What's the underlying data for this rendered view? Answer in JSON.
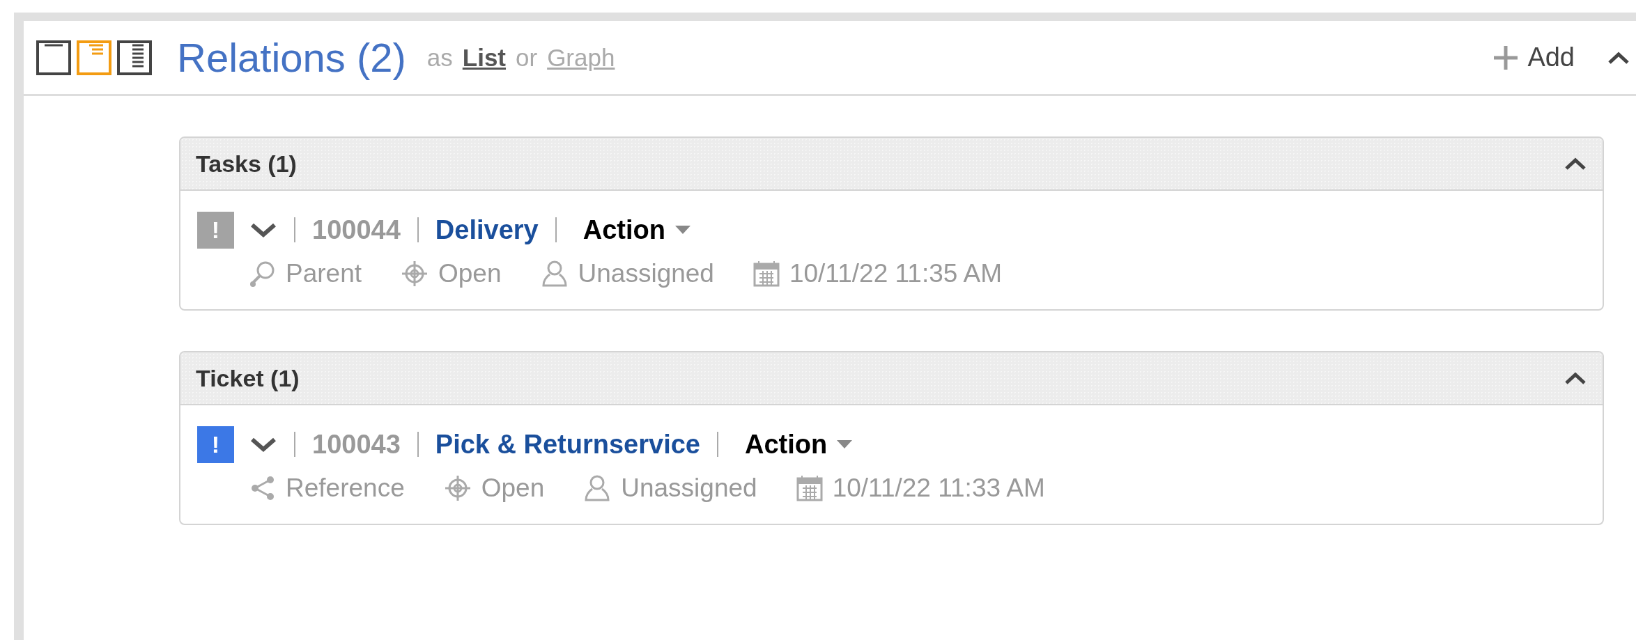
{
  "panel": {
    "view_modes": [
      {
        "kind": "blank",
        "selected": false
      },
      {
        "kind": "partial",
        "selected": true
      },
      {
        "kind": "full",
        "selected": false
      }
    ],
    "title": "Relations (2)",
    "view_switch": {
      "prefix": "as",
      "joiner": "or",
      "options": [
        {
          "label": "List",
          "selected": true
        },
        {
          "label": "Graph",
          "selected": false
        }
      ]
    },
    "add_button": "Add",
    "expanded": true
  },
  "groups": [
    {
      "title": "Tasks (1)",
      "expanded": true,
      "items": [
        {
          "priority_mark": "!",
          "color": "#a3a3a3",
          "id": "100044",
          "name": "Delivery",
          "action": "Action",
          "relation": {
            "kind": "parent",
            "label": "Parent"
          },
          "status": "Open",
          "assignee": "Unassigned",
          "date": "10/11/22 11:35 AM"
        }
      ]
    },
    {
      "title": "Ticket (1)",
      "expanded": true,
      "items": [
        {
          "priority_mark": "!",
          "color": "#3c78e6",
          "id": "100043",
          "name": "Pick & Returnservice",
          "action": "Action",
          "relation": {
            "kind": "reference",
            "label": "Reference"
          },
          "status": "Open",
          "assignee": "Unassigned",
          "date": "10/11/22 11:33 AM"
        }
      ]
    }
  ]
}
